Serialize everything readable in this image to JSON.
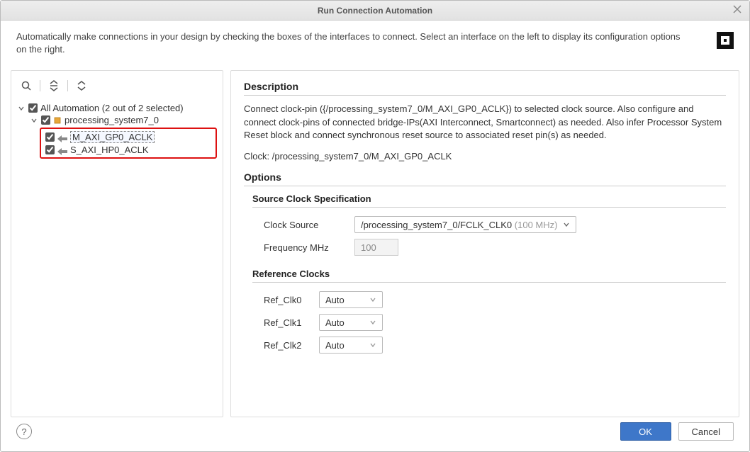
{
  "window": {
    "title": "Run Connection Automation"
  },
  "intro_text": "Automatically make connections in your design by checking the boxes of the interfaces to connect. Select an interface on the left to display its configuration options on the right.",
  "tree": {
    "root_label": "All Automation (2 out of 2 selected)",
    "root_checked": true,
    "device_label": "processing_system7_0",
    "device_checked": true,
    "pin1_label": "M_AXI_GP0_ACLK",
    "pin1_checked": true,
    "pin2_label": "S_AXI_HP0_ACLK",
    "pin2_checked": true
  },
  "description": {
    "heading": "Description",
    "body": "Connect clock-pin ({/processing_system7_0/M_AXI_GP0_ACLK}) to selected clock source. Also configure and connect clock-pins of connected bridge-IPs(AXI Interconnect, Smartconnect) as needed. Also infer Processor System Reset block and connect synchronous reset source to associated reset pin(s) as needed.",
    "clock_line": "Clock: /processing_system7_0/M_AXI_GP0_ACLK"
  },
  "options": {
    "heading": "Options",
    "source_spec_heading": "Source Clock Specification",
    "clock_source_label": "Clock Source",
    "clock_source_value_main": "/processing_system7_0/FCLK_CLK0",
    "clock_source_value_suffix": " (100 MHz)",
    "freq_label": "Frequency MHz",
    "freq_value": "100",
    "ref_clocks_heading": "Reference Clocks",
    "ref0_label": "Ref_Clk0",
    "ref0_value": "Auto",
    "ref1_label": "Ref_Clk1",
    "ref1_value": "Auto",
    "ref2_label": "Ref_Clk2",
    "ref2_value": "Auto"
  },
  "buttons": {
    "ok": "OK",
    "cancel": "Cancel"
  },
  "icons": {
    "help": "?",
    "chevron_down": "▾",
    "dropdown_arrow": "▾"
  }
}
